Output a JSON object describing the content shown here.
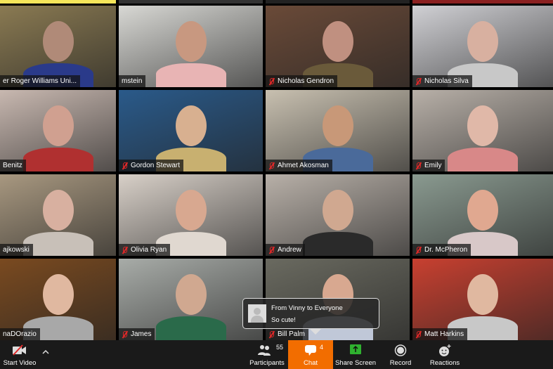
{
  "gallery": {
    "tiles": [
      {
        "name": "er Roger Williams Uni...",
        "muted": false,
        "bg": "#8a7a52",
        "skin": "#b08a78",
        "shirt": "#2a3a8a"
      },
      {
        "name": "mstein",
        "muted": false,
        "bg": "#d8d8d4",
        "skin": "#c89880",
        "shirt": "#e8b4b4"
      },
      {
        "name": "Nicholas Gendron",
        "muted": true,
        "bg": "#6a4a38",
        "skin": "#c09080",
        "shirt": "#6a5a3a"
      },
      {
        "name": "Nicholas Silva",
        "muted": true,
        "bg": "#d0d0d4",
        "skin": "#d8b0a0",
        "shirt": "#c8c8c8"
      },
      {
        "name": "Benitz",
        "muted": false,
        "bg": "#c8b8b0",
        "skin": "#d0a090",
        "shirt": "#b03030"
      },
      {
        "name": "Gordon Stewart",
        "muted": true,
        "bg": "#2a5a8a",
        "skin": "#d8b090",
        "shirt": "#c8b070"
      },
      {
        "name": "Ahmet Akosman",
        "muted": true,
        "bg": "#c8c0b0",
        "skin": "#c89878",
        "shirt": "#4a6a9a"
      },
      {
        "name": "Emily",
        "muted": true,
        "bg": "#b8b0a8",
        "skin": "#e0b8a8",
        "shirt": "#d88888"
      },
      {
        "name": "ajkowski",
        "muted": false,
        "bg": "#a89880",
        "skin": "#d8b0a0",
        "shirt": "#c8c0b8"
      },
      {
        "name": "Olivia Ryan",
        "muted": true,
        "bg": "#d8d0c8",
        "skin": "#d8a890",
        "shirt": "#e0d8d0"
      },
      {
        "name": "Andrew",
        "muted": true,
        "bg": "#b8b0a8",
        "skin": "#d0a890",
        "shirt": "#2a2a2a"
      },
      {
        "name": "Dr. McPheron",
        "muted": true,
        "bg": "#8a9a90",
        "skin": "#e0a890",
        "shirt": "#d8c8c8"
      },
      {
        "name": "naDOrazio",
        "muted": false,
        "bg": "#7a4a20",
        "skin": "#e0b8a0",
        "shirt": "#a8a8a8"
      },
      {
        "name": "James",
        "muted": true,
        "bg": "#a8aca8",
        "skin": "#d0a890",
        "shirt": "#2a6a4a"
      },
      {
        "name": "Bill Palm",
        "muted": true,
        "bg": "#6a6a60",
        "skin": "#d8a890",
        "shirt": "#c0c8d8"
      },
      {
        "name": "Matt Harkins",
        "muted": true,
        "bg": "#c84030",
        "skin": "#e0b8a0",
        "shirt": "#c8c8c8"
      }
    ],
    "active_speaker_color": "#f5e55a"
  },
  "chat_popup": {
    "from": "From Vinny to Everyone",
    "message": "So cute!"
  },
  "toolbar": {
    "start_video": "Start Video",
    "participants": "Participants",
    "participants_count": "55",
    "chat": "Chat",
    "chat_count": "4",
    "share_screen": "Share Screen",
    "record": "Record",
    "reactions": "Reactions",
    "accent": "#f26d00",
    "share_green": "#2fb12f"
  }
}
